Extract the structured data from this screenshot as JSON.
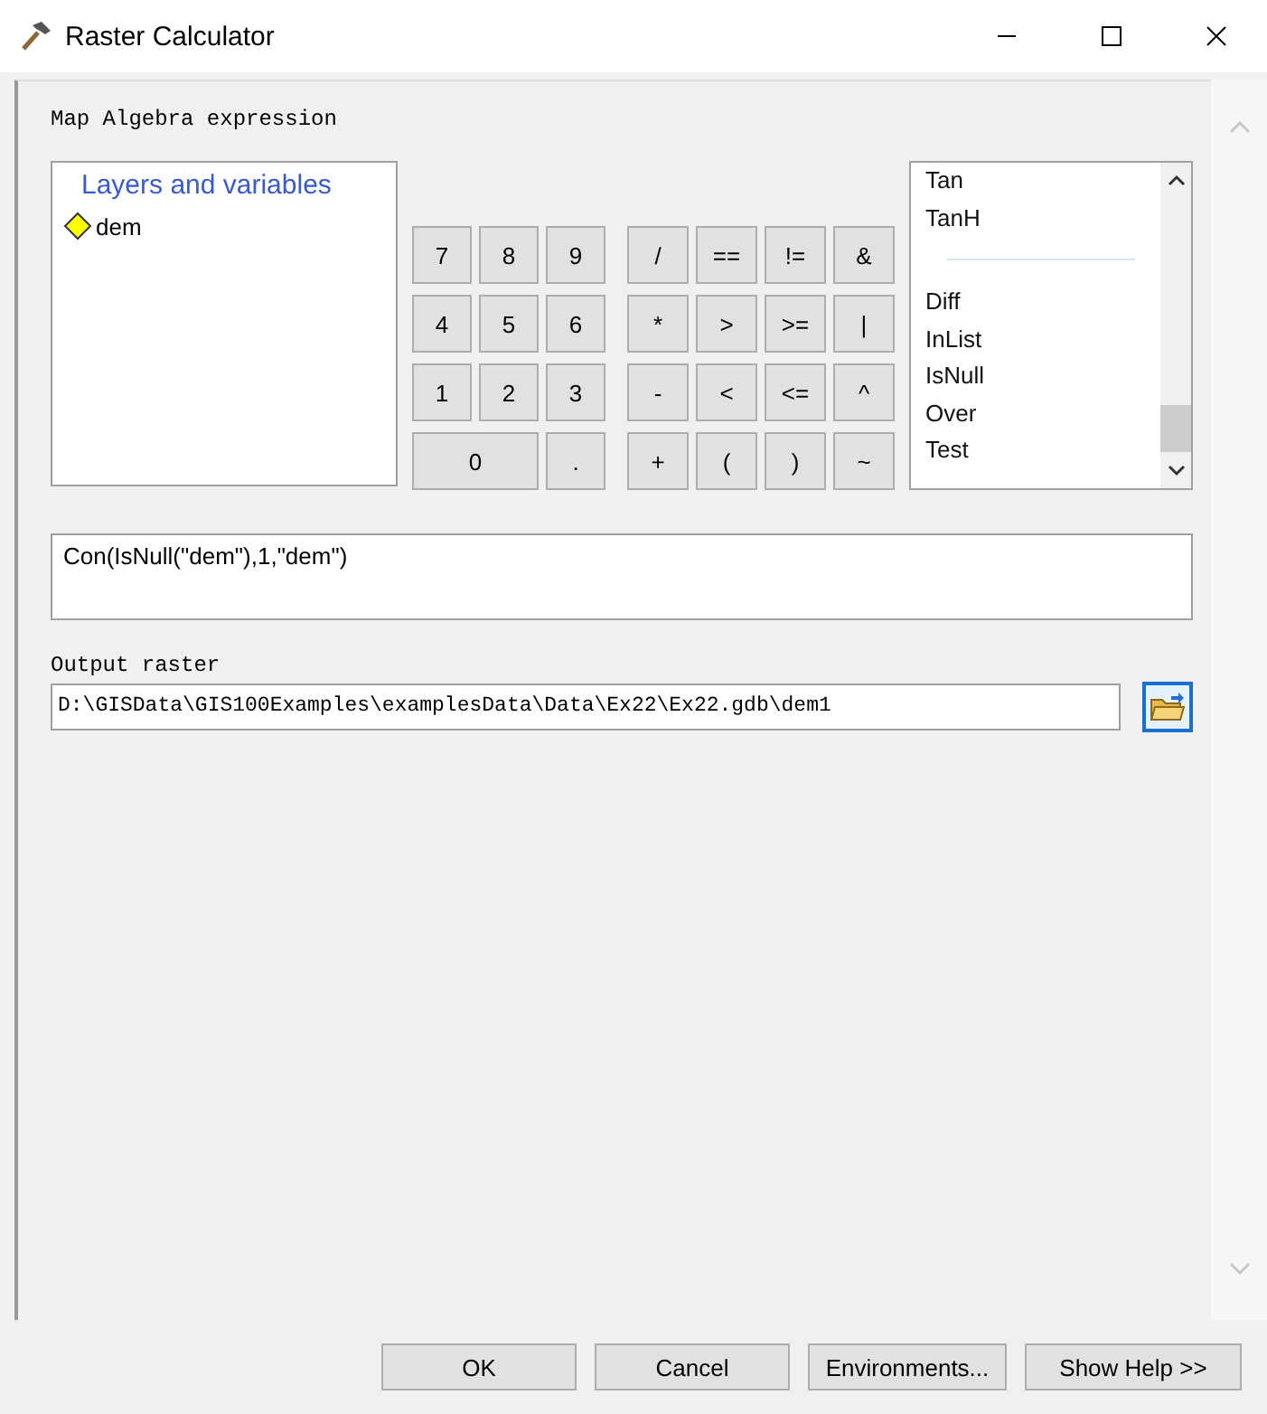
{
  "window": {
    "title": "Raster Calculator"
  },
  "expression_label": "Map Algebra expression",
  "layers": {
    "heading": "Layers and variables",
    "items": [
      "dem"
    ]
  },
  "keypad": {
    "number_keys": [
      {
        "label": "7",
        "wide": false
      },
      {
        "label": "8",
        "wide": false
      },
      {
        "label": "9",
        "wide": false
      },
      {
        "label": "4",
        "wide": false
      },
      {
        "label": "5",
        "wide": false
      },
      {
        "label": "6",
        "wide": false
      },
      {
        "label": "1",
        "wide": false
      },
      {
        "label": "2",
        "wide": false
      },
      {
        "label": "3",
        "wide": false
      },
      {
        "label": "0",
        "wide": true
      },
      {
        "label": ".",
        "wide": false
      }
    ],
    "operator_keys": [
      "/",
      "==",
      "!=",
      "&",
      "*",
      ">",
      ">=",
      "|",
      "-",
      "<",
      "<=",
      "^",
      "+",
      "(",
      ")",
      "~"
    ]
  },
  "functions": [
    {
      "kind": "item",
      "label": "Tan"
    },
    {
      "kind": "item",
      "label": "TanH"
    },
    {
      "kind": "separator"
    },
    {
      "kind": "item",
      "label": "Diff"
    },
    {
      "kind": "item",
      "label": "InList"
    },
    {
      "kind": "item",
      "label": "IsNull"
    },
    {
      "kind": "item",
      "label": "Over"
    },
    {
      "kind": "item",
      "label": "Test"
    }
  ],
  "expression": "Con(IsNull(\"dem\"),1,\"dem\")",
  "output": {
    "label": "Output raster",
    "value": "D:\\GISData\\GIS100Examples\\examplesData\\Data\\Ex22\\Ex22.gdb\\dem1"
  },
  "buttons": [
    "OK",
    "Cancel",
    "Environments...",
    "Show Help >>"
  ]
}
